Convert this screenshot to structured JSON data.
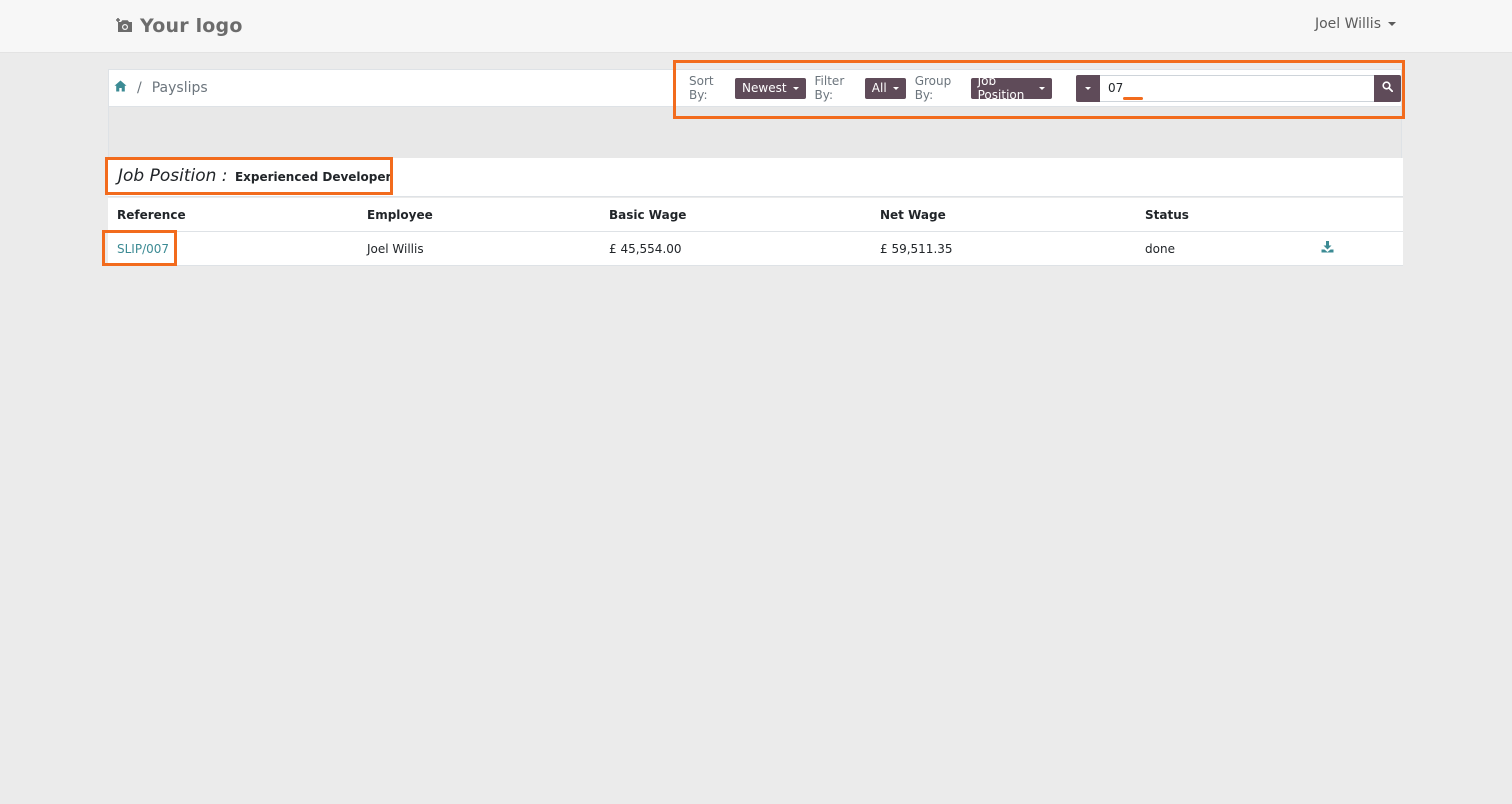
{
  "header": {
    "logo_text": "Your logo",
    "user_name": "Joel Willis"
  },
  "breadcrumb": {
    "home_icon": "home-icon",
    "current": "Payslips"
  },
  "controls": {
    "sort_label": "Sort By:",
    "sort_value": "Newest",
    "filter_label": "Filter By:",
    "filter_value": "All",
    "group_label": "Group By:",
    "group_value": "Job Position",
    "search_value": "07",
    "search_icon": "search-icon"
  },
  "group": {
    "label": "Job Position :",
    "value": "Experienced Developer"
  },
  "table": {
    "columns": [
      "Reference",
      "Employee",
      "Basic Wage",
      "Net Wage",
      "Status"
    ],
    "rows": [
      {
        "reference": "SLIP/007",
        "employee": "Joel Willis",
        "basic_wage": "£ 45,554.00",
        "net_wage": "£ 59,511.35",
        "status": "done",
        "action_icon": "download-icon"
      }
    ]
  },
  "colors": {
    "accent": "#5f4b59",
    "link": "#3c8b94",
    "highlight": "#f26b1d"
  }
}
